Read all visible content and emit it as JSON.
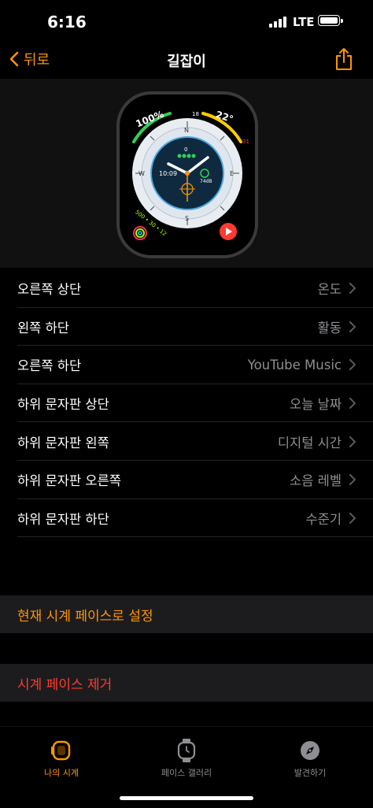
{
  "status": {
    "time": "6:16",
    "network": "LTE"
  },
  "nav": {
    "back_label": "뒤로",
    "title": "길잡이"
  },
  "watch": {
    "battery": "100%",
    "temp": "22°",
    "temp_low": "18",
    "temp_high": "31",
    "top_small": "0",
    "digital_time": "10:09",
    "noise": "74dB",
    "activity": "500 • 30 • 12",
    "dial_n": "N",
    "dial_e": "E",
    "dial_s": "S",
    "dial_w": "W"
  },
  "settings": [
    {
      "label": "오른쪽 상단",
      "value": "온도"
    },
    {
      "label": "왼쪽 하단",
      "value": "활동"
    },
    {
      "label": "오른쪽 하단",
      "value": "YouTube Music"
    },
    {
      "label": "하위 문자판 상단",
      "value": "오늘 날짜"
    },
    {
      "label": "하위 문자판 왼쪽",
      "value": "디지털 시간"
    },
    {
      "label": "하위 문자판 오른쪽",
      "value": "소음 레벨"
    },
    {
      "label": "하위 문자판 하단",
      "value": "수준기"
    }
  ],
  "actions": {
    "set_current": "현재 시계 페이스로 설정",
    "remove": "시계 페이스 제거"
  },
  "tabs": [
    {
      "label": "나의 시계",
      "icon": "watch-icon",
      "active": true
    },
    {
      "label": "페이스 갤러리",
      "icon": "watch-gallery-icon",
      "active": false
    },
    {
      "label": "발견하기",
      "icon": "compass-icon",
      "active": false
    }
  ],
  "colors": {
    "accent": "#ff9500",
    "destructive": "#ff3b30",
    "secondary": "#8e8e93"
  }
}
